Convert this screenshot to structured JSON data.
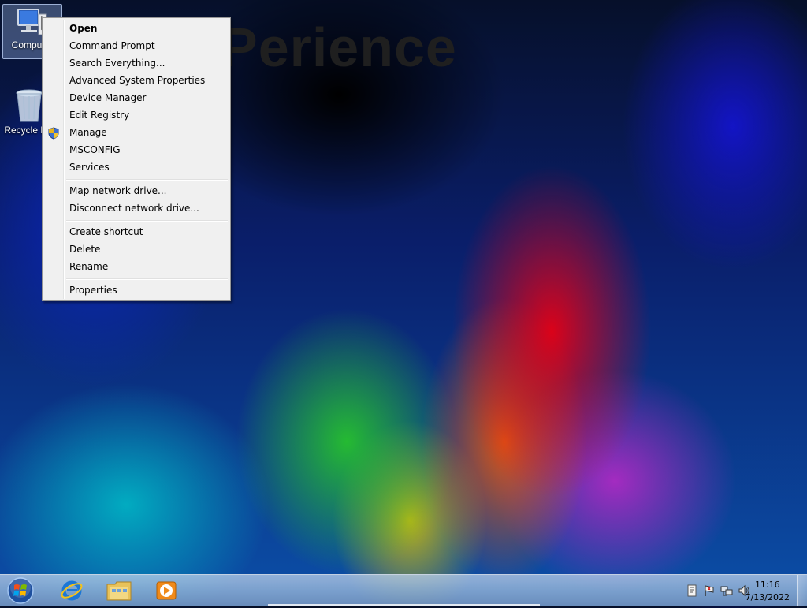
{
  "wallpaper": {
    "brand_text": "Perience"
  },
  "desktop": {
    "icons": [
      {
        "label": "Computer",
        "icon": "computer-icon"
      },
      {
        "label": "Recycle Bin",
        "icon": "recycle-bin-icon"
      }
    ]
  },
  "context_menu": {
    "items": [
      {
        "label": "Open",
        "bold": true
      },
      {
        "label": "Command Prompt"
      },
      {
        "label": "Search Everything..."
      },
      {
        "label": "Advanced System Properties"
      },
      {
        "label": "Device Manager"
      },
      {
        "label": "Edit Registry"
      },
      {
        "label": "Manage",
        "icon": "uac-shield-icon"
      },
      {
        "label": "MSCONFIG"
      },
      {
        "label": "Services"
      },
      {
        "label": "Map network drive..."
      },
      {
        "label": "Disconnect network drive..."
      },
      {
        "label": "Create shortcut"
      },
      {
        "label": "Delete"
      },
      {
        "label": "Rename"
      },
      {
        "label": "Properties"
      }
    ]
  },
  "taskbar": {
    "start_icon": "windows-orb-icon",
    "pinned": [
      "internet-explorer-icon",
      "windows-explorer-icon",
      "media-player-icon"
    ],
    "tray": [
      "notification-icon",
      "action-center-flag-icon",
      "network-icon",
      "volume-icon"
    ],
    "clock": {
      "time": "11:16",
      "date": "7/13/2022"
    }
  }
}
